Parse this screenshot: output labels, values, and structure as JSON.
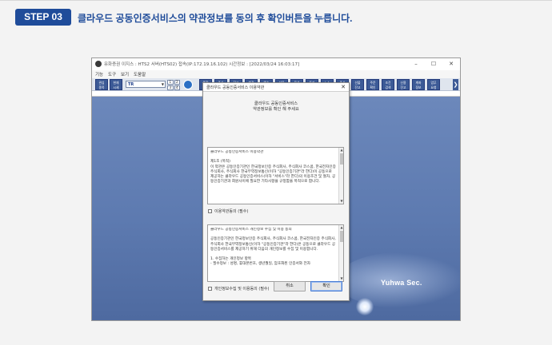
{
  "header": {
    "step": "STEP 03",
    "instruction": "클라우드 공동인증서비스의 약관정보를 동의 후 확인버튼을 누릅니다."
  },
  "window": {
    "title": "유화증권 이지스 : HTS2 서버(HTS02) 접속(IP:172.19.16.102)   시간정보 : [2022/03/24 16:03:17]",
    "controls": {
      "minimize": "–",
      "maximize": "☐",
      "close": "✕"
    },
    "menu": [
      "기능",
      "도구",
      "보기",
      "도움말"
    ]
  },
  "toolbar": {
    "left_buttons": [
      "관심\n종목",
      "현재\n시세"
    ],
    "select_value": "TR",
    "grid": [
      "1",
      "2",
      "3",
      "4"
    ],
    "right_buttons": [
      "종합\n차트",
      "주식\n주문",
      "잔고\n평가",
      "체결\n내역",
      "예수\n금",
      "선물\n주문",
      "옵션\n시세",
      "투자\n정보",
      "뉴스\n공시",
      "주식\n현재",
      "선물\n잔고",
      "주문\n확인",
      "조건\n검색",
      "신용\n잔고",
      "계좌\n정보",
      "업무\n요청"
    ],
    "scroll": "❯"
  },
  "brand": "Yuhwa Sec.",
  "dialog": {
    "title": "클라우드 공동인증서비스 이용약관",
    "close": "✕",
    "heading": "클라우드 공동인증서비스\n약관정보를 확인 해 주세요",
    "terms1": {
      "text": "클라우드 공동인증서비스 이용약관\n\n제1조 (목적)\n이 약관은 공동인증기관인 한국정보인증 주식회사, 주식회사 코스콤, 한국전자인증 주식회사, 주식회사 한국무역정보통신(이하 \"공동인증기관\"라 한다)이 공동으로 제공하는 클라우드 공동인증서비스(이하 \"서비스\"라 한다)의 이용조건 및 절차, 공동인증기관과 회원사이에 필요한 기타사항을 규정함을 목적으로 합니다.",
      "checkbox": "이용약관동의 (필수)"
    },
    "terms2": {
      "text": "클라우드 공동인증서비스 개인정보 수집 및 이용 동의\n\n공동인증기관인 한국정보인증 주식회사, 주식회사 코스콤, 한국전자인증 주식회사, 주식회사 한국무역정보통신(이하 \"공동인증기관\"라 한다)은 공동으로 클라우드 공동인증서비스를 제공하기 위해 다음의 개인정보를 수집 및 이용합니다.\n\n1. 수집하는 개인정보 항목\n- 필수정보 : 성명, 휴대폰번호, 생년월일, 암호화된 인증서와 전자",
      "checkbox": "개인정보수집 및 이용동의 (필수)"
    },
    "cancel_label": "취소",
    "confirm_label": "확인"
  }
}
